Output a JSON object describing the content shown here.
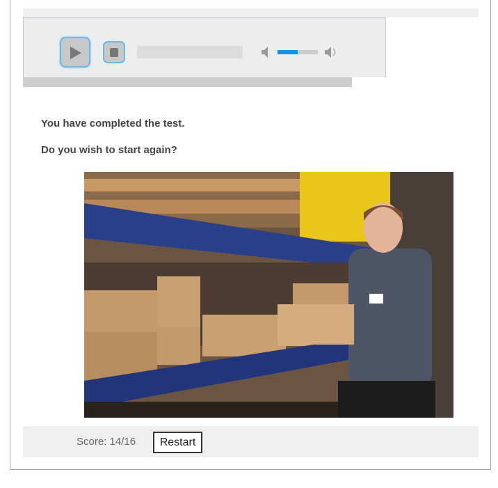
{
  "player": {
    "volume_percent": 50,
    "progress_percent": 0
  },
  "messages": {
    "completed": "You have completed the test.",
    "again": "Do you wish to start again?"
  },
  "footer": {
    "score_label": "Score: 14/16",
    "restart_label": "Restart"
  },
  "colors": {
    "accent": "#0d96e0",
    "panel": "#ededed"
  }
}
